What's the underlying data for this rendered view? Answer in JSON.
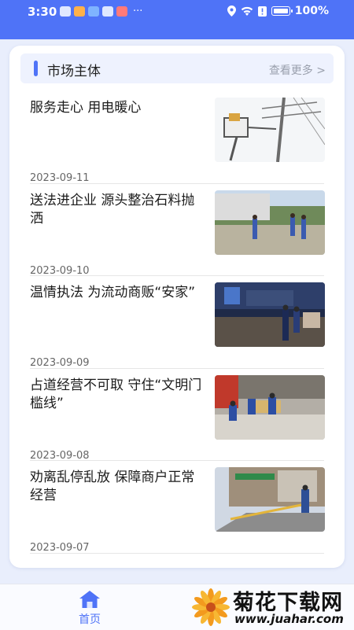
{
  "status_bar": {
    "time": "3:30",
    "battery_percent": "100%",
    "more_dots": "···"
  },
  "section": {
    "title": "市场主体",
    "more_label": "查看更多 >"
  },
  "news": [
    {
      "title": "服务走心 用电暖心",
      "date": "2023-09-11"
    },
    {
      "title": "送法进企业 源头整治石料抛洒",
      "date": "2023-09-10"
    },
    {
      "title": "温情执法 为流动商贩“安家”",
      "date": "2023-09-09"
    },
    {
      "title": "占道经营不可取 守住“文明门槛线”",
      "date": "2023-09-08"
    },
    {
      "title": "劝离乱停乱放 保障商户正常经营",
      "date": "2023-09-07"
    }
  ],
  "bottom_nav": {
    "home_label": "首页"
  },
  "watermark": {
    "brand": "菊花下载网",
    "url": "www.juahar.com"
  },
  "colors": {
    "accent": "#4f73f7",
    "background": "#e9eefc",
    "card": "#ffffff"
  }
}
